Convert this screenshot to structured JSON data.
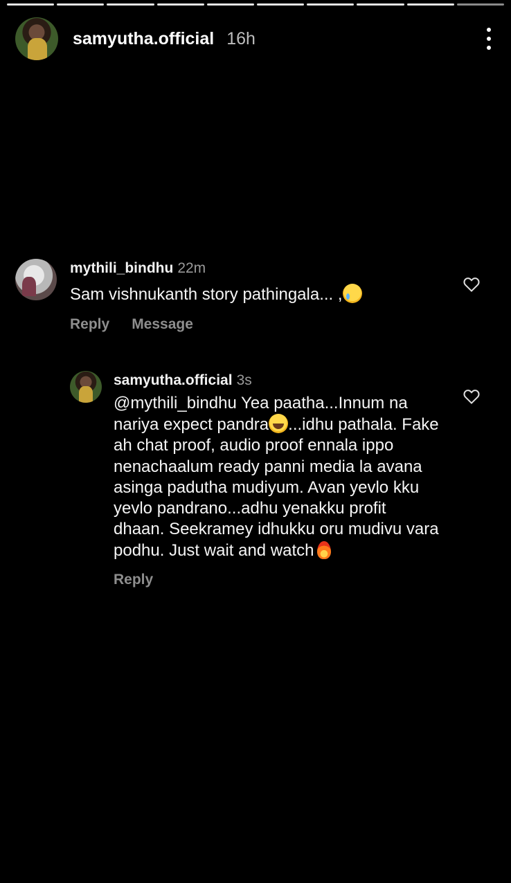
{
  "progress": {
    "segments": 10,
    "current": 10
  },
  "story": {
    "username": "samyutha.official",
    "time": "16h"
  },
  "comments": [
    {
      "username": "mythili_bindhu",
      "time": "22m",
      "text": "Sam vishnukanth story pathingala... ,",
      "emoji": "crying-face",
      "actions": [
        "Reply",
        "Message"
      ]
    },
    {
      "username": "samyutha.official",
      "time": "3s",
      "text_parts": [
        "@mythili_bindhu Yea paatha...Innum na nariya expect pandra",
        "...idhu pathala. Fake ah chat proof, audio proof ennala ippo nenachaalum ready panni media la avana asinga padutha mudiyum. Avan yevlo kku yevlo pandrano...adhu yenakku profit dhaan. Seekramey idhukku oru mudivu vara podhu. Just wait and watch"
      ],
      "emojis": [
        "laughing-tears",
        "fire"
      ],
      "actions": [
        "Reply"
      ]
    }
  ]
}
